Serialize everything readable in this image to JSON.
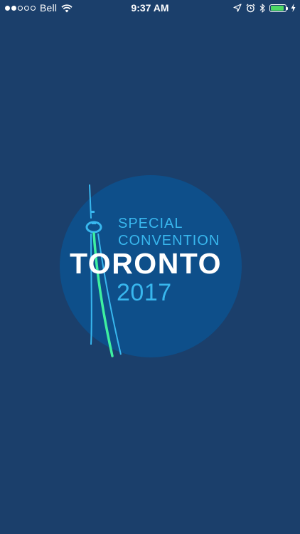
{
  "status_bar": {
    "carrier": "Bell",
    "time": "9:37 AM",
    "signal_bars_full": 2,
    "signal_bars_total": 5,
    "battery_level": 0.9,
    "icons": [
      "wifi-icon",
      "location-arrow-icon",
      "alarm-clock-icon",
      "bluetooth-icon",
      "battery-icon",
      "charging-bolt-icon"
    ]
  },
  "logo": {
    "line1": "SPECIAL",
    "line2": "CONVENTION",
    "city": "TORONTO",
    "year": "2017"
  },
  "colors": {
    "background": "#1b3f6b",
    "circle": "#0e4f8a",
    "accent_blue": "#38b7ee",
    "accent_green": "#3ef0a0",
    "battery_green": "#4cd964"
  }
}
